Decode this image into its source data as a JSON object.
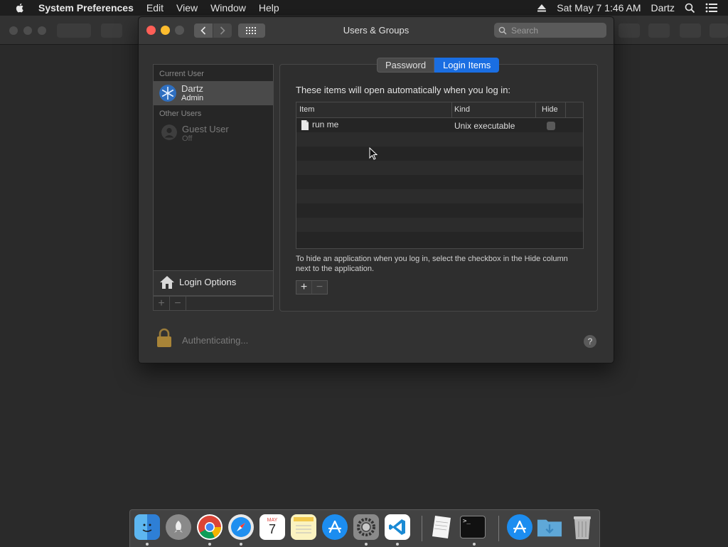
{
  "menubar": {
    "app_name": "System Preferences",
    "menus": [
      "Edit",
      "View",
      "Window",
      "Help"
    ],
    "clock": "Sat May 7  1:46 AM",
    "user": "Dartz"
  },
  "window": {
    "title": "Users & Groups",
    "search_placeholder": "Search"
  },
  "sidebar": {
    "current_user_header": "Current User",
    "current_user": {
      "name": "Dartz",
      "role": "Admin"
    },
    "other_users_header": "Other Users",
    "other_user": {
      "name": "Guest User",
      "status": "Off"
    },
    "login_options_label": "Login Options"
  },
  "tabs": [
    {
      "label": "Password",
      "active": false
    },
    {
      "label": "Login Items",
      "active": true
    }
  ],
  "login_items": {
    "intro": "These items will open automatically when you log in:",
    "columns": {
      "item": "Item",
      "kind": "Kind",
      "hide": "Hide"
    },
    "rows": [
      {
        "item": "run me",
        "kind": "Unix executable",
        "hide": false
      }
    ],
    "hint": "To hide an application when you log in, select the checkbox in the Hide column next to the application."
  },
  "footer": {
    "auth_status": "Authenticating...",
    "help_label": "?"
  },
  "dock": {
    "apps": [
      "finder",
      "launchpad",
      "chrome",
      "safari",
      "calendar",
      "notes",
      "app-store",
      "system-preferences",
      "vscode",
      "textedit",
      "terminal",
      "app-store-alt",
      "downloads",
      "trash"
    ],
    "calendar": {
      "month": "MAY",
      "day": "7"
    }
  },
  "colors": {
    "accent": "#1a6ee2",
    "close": "#ff5f57",
    "minimize": "#febc2e"
  }
}
